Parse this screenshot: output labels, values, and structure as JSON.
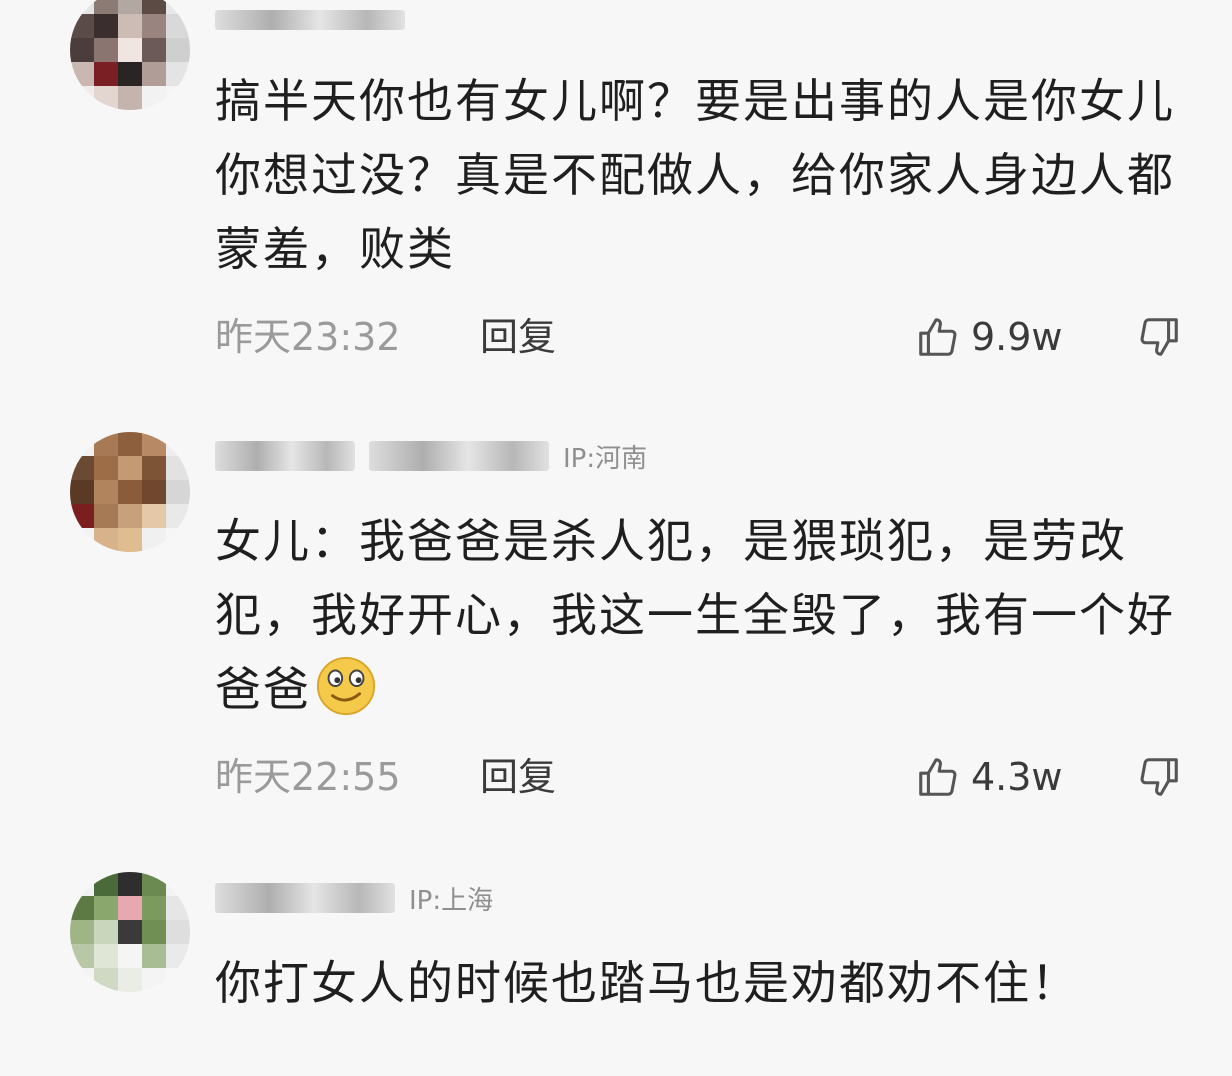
{
  "comments": [
    {
      "username": "",
      "ip": "",
      "text": "搞半天你也有女儿啊？要是出事的人是你女儿你想过没？真是不配做人，给你家人身边人都蒙羞，败类",
      "time": "昨天23:32",
      "reply_label": "回复",
      "likes": "9.9w"
    },
    {
      "username": "",
      "ip": "IP:河南",
      "text": "女儿：我爸爸是杀人犯，是猥琐犯，是劳改犯，我好开心，我这一生全毁了，我有一个好爸爸",
      "emoji": "smirk-face-emoji",
      "time": "昨天22:55",
      "reply_label": "回复",
      "likes": "4.3w"
    },
    {
      "username": "",
      "ip": "IP:上海",
      "text": "你打女人的时候也踏马也是劝都劝不住！"
    }
  ],
  "icons": {
    "like": "thumbs-up-icon",
    "dislike": "thumbs-down-icon"
  },
  "colors": {
    "background": "#f7f7f7",
    "text": "#1f1f1f",
    "meta": "#9a9a9a"
  }
}
